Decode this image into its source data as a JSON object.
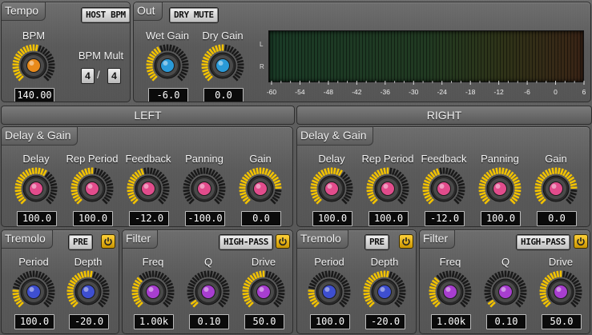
{
  "tempo": {
    "title": "Tempo",
    "host_bpm_label": "HOST BPM",
    "bpm": {
      "label": "BPM",
      "value": "140.00",
      "level": 0.55,
      "color": "#e88a1a"
    },
    "bpm_mult": {
      "label": "BPM Mult",
      "numerator": "4",
      "separator": "/",
      "denominator": "4"
    }
  },
  "out": {
    "title": "Out",
    "dry_mute_label": "DRY MUTE",
    "wet_gain": {
      "label": "Wet Gain",
      "value": "-6.0",
      "level": 0.42,
      "color": "#2a9ad8"
    },
    "dry_gain": {
      "label": "Dry Gain",
      "value": "0.0",
      "level": 0.5,
      "color": "#2a9ad8"
    },
    "meter": {
      "channel_labels": [
        "L",
        "R"
      ],
      "scale": [
        "-60",
        "-54",
        "-48",
        "-42",
        "-36",
        "-30",
        "-24",
        "-18",
        "-12",
        "-6",
        "0",
        "6"
      ]
    }
  },
  "channels": [
    {
      "header": "LEFT",
      "delay_gain": {
        "title": "Delay & Gain",
        "knobs": [
          {
            "label": "Delay",
            "value": "100.0",
            "level": 0.62,
            "color": "#e24c8c"
          },
          {
            "label": "Rep Period",
            "value": "100.0",
            "level": 0.5,
            "color": "#e24c8c"
          },
          {
            "label": "Feedback",
            "value": "-12.0",
            "level": 0.45,
            "color": "#e24c8c"
          },
          {
            "label": "Panning",
            "value": "-100.0",
            "level": 0.0,
            "color": "#e24c8c"
          },
          {
            "label": "Gain",
            "value": "0.0",
            "level": 0.85,
            "color": "#e24c8c"
          }
        ]
      },
      "tremolo": {
        "title": "Tremolo",
        "pre_label": "PRE",
        "knobs": [
          {
            "label": "Period",
            "value": "100.0",
            "level": 0.2,
            "color": "#3e4fd0"
          },
          {
            "label": "Depth",
            "value": "-20.0",
            "level": 0.55,
            "color": "#3e4fd0"
          }
        ]
      },
      "filter": {
        "title": "Filter",
        "mode_label": "HIGH-PASS",
        "knobs": [
          {
            "label": "Freq",
            "value": "1.00k",
            "level": 0.35,
            "color": "#a83ed0"
          },
          {
            "label": "Q",
            "value": "0.10",
            "level": 0.05,
            "color": "#a83ed0"
          },
          {
            "label": "Drive",
            "value": "50.0",
            "level": 0.5,
            "color": "#a83ed0"
          }
        ]
      }
    },
    {
      "header": "RIGHT",
      "delay_gain": {
        "title": "Delay & Gain",
        "knobs": [
          {
            "label": "Delay",
            "value": "100.0",
            "level": 0.62,
            "color": "#e24c8c"
          },
          {
            "label": "Rep Period",
            "value": "100.0",
            "level": 0.5,
            "color": "#e24c8c"
          },
          {
            "label": "Feedback",
            "value": "-12.0",
            "level": 0.45,
            "color": "#e24c8c"
          },
          {
            "label": "Panning",
            "value": "100.0",
            "level": 1.0,
            "color": "#e24c8c"
          },
          {
            "label": "Gain",
            "value": "0.0",
            "level": 0.85,
            "color": "#e24c8c"
          }
        ]
      },
      "tremolo": {
        "title": "Tremolo",
        "pre_label": "PRE",
        "knobs": [
          {
            "label": "Period",
            "value": "100.0",
            "level": 0.2,
            "color": "#3e4fd0"
          },
          {
            "label": "Depth",
            "value": "-20.0",
            "level": 0.55,
            "color": "#3e4fd0"
          }
        ]
      },
      "filter": {
        "title": "Filter",
        "mode_label": "HIGH-PASS",
        "knobs": [
          {
            "label": "Freq",
            "value": "1.00k",
            "level": 0.35,
            "color": "#a83ed0"
          },
          {
            "label": "Q",
            "value": "0.10",
            "level": 0.05,
            "color": "#a83ed0"
          },
          {
            "label": "Drive",
            "value": "50.0",
            "level": 0.5,
            "color": "#a83ed0"
          }
        ]
      }
    }
  ],
  "icons": {
    "power": "power-icon"
  },
  "colors": {
    "accent": "#f2c200",
    "ring_off": "#1a1a1a"
  }
}
